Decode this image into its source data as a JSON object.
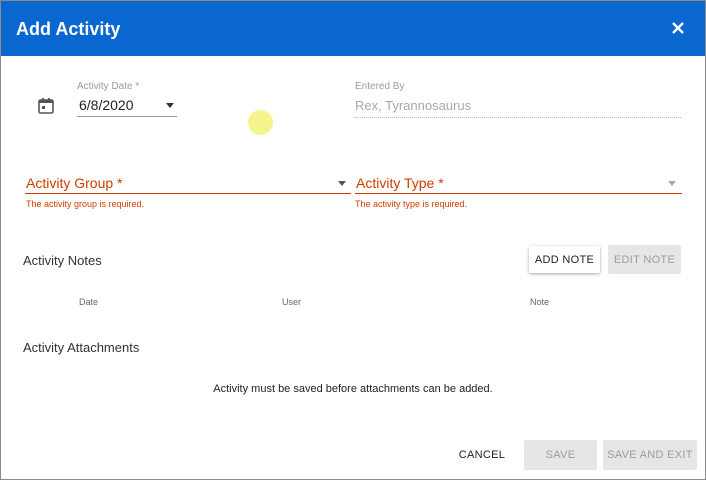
{
  "dialog": {
    "title": "Add Activity"
  },
  "form": {
    "activity_date": {
      "label": "Activity Date *",
      "value": "6/8/2020"
    },
    "entered_by": {
      "label": "Entered By",
      "value": "Rex, Tyrannosaurus"
    },
    "activity_group": {
      "label": "Activity Group *",
      "error": "The activity group is required."
    },
    "activity_type": {
      "label": "Activity Type *",
      "error": "The activity type is required."
    }
  },
  "notes": {
    "heading": "Activity Notes",
    "add_label": "ADD NOTE",
    "edit_label": "EDIT NOTE",
    "columns": [
      "Date",
      "User",
      "Note"
    ]
  },
  "attachments": {
    "heading": "Activity Attachments",
    "message": "Activity must be saved before attachments can be added."
  },
  "footer": {
    "cancel_label": "CANCEL",
    "save_label": "SAVE",
    "save_exit_label": "SAVE AND EXIT"
  },
  "colors": {
    "header": "#0a67d0",
    "error": "#cc3d00"
  }
}
